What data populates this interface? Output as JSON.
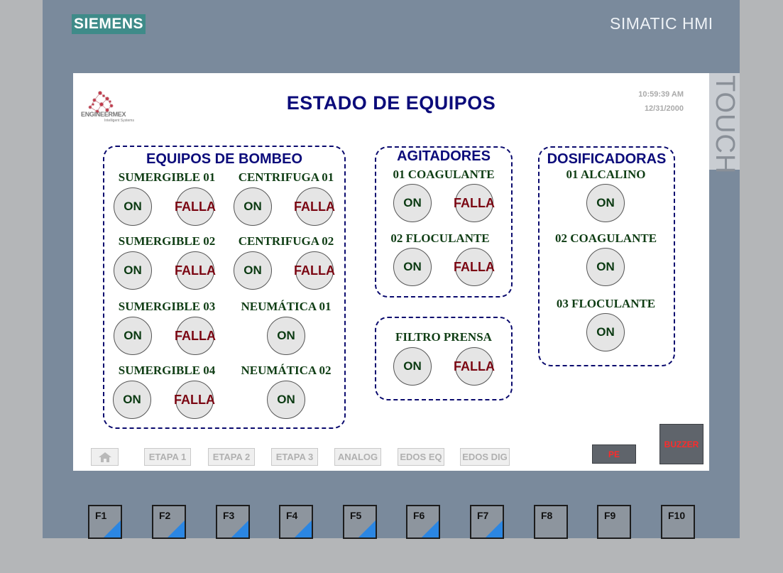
{
  "device": {
    "brand": "SIEMENS",
    "model": "SIMATIC HMI",
    "touch_label": "TOUCH"
  },
  "header": {
    "logo_text": "ENGINEERMEX",
    "logo_subtext": "Intelligent Systems",
    "title": "ESTADO DE EQUIPOS",
    "time": "10:59:39 AM",
    "date": "12/31/2000"
  },
  "bombeo": {
    "title": "EQUIPOS DE BOMBEO",
    "sumergible_01": "SUMERGIBLE 01",
    "sumergible_02": "SUMERGIBLE 02",
    "sumergible_03": "SUMERGIBLE 03",
    "sumergible_04": "SUMERGIBLE 04",
    "centrifuga_01": "CENTRIFUGA 01",
    "centrifuga_02": "CENTRIFUGA 02",
    "neumatica_01": "NEUMÁTICA 01",
    "neumatica_02": "NEUMÁTICA 02"
  },
  "agitadores": {
    "title": "AGITADORES",
    "coagulante_01": "01 COAGULANTE",
    "floculante_02": "02 FLOCULANTE"
  },
  "filtro": {
    "title": "FILTRO PRENSA"
  },
  "dosificadoras": {
    "title": "DOSIFICADORAS",
    "alcalino_01": "01 ALCALINO",
    "coagulante_02": "02 COAGULANTE",
    "floculante_03": "03 FLOCULANTE"
  },
  "states": {
    "on": "ON",
    "falla": "FALLA"
  },
  "nav": {
    "home_icon": "home-icon",
    "etapa1": "ETAPA 1",
    "etapa2": "ETAPA 2",
    "etapa3": "ETAPA 3",
    "analog": "ANALOG",
    "edos_eq": "EDOS EQ",
    "edos_dig": "EDOS DIG",
    "pe": "PE",
    "buzzer": "BUZZER"
  },
  "fkeys": [
    "F1",
    "F2",
    "F3",
    "F4",
    "F5",
    "F6",
    "F7",
    "F8",
    "F9",
    "F10"
  ],
  "colors": {
    "bezel": "#7a8a9c",
    "brand": "#3f8b89",
    "title": "#0b0b7a",
    "label": "#0f3d14",
    "falla": "#7b0612",
    "alarm_text": "#ff2a2a",
    "fkey_accent": "#2b86e2"
  }
}
